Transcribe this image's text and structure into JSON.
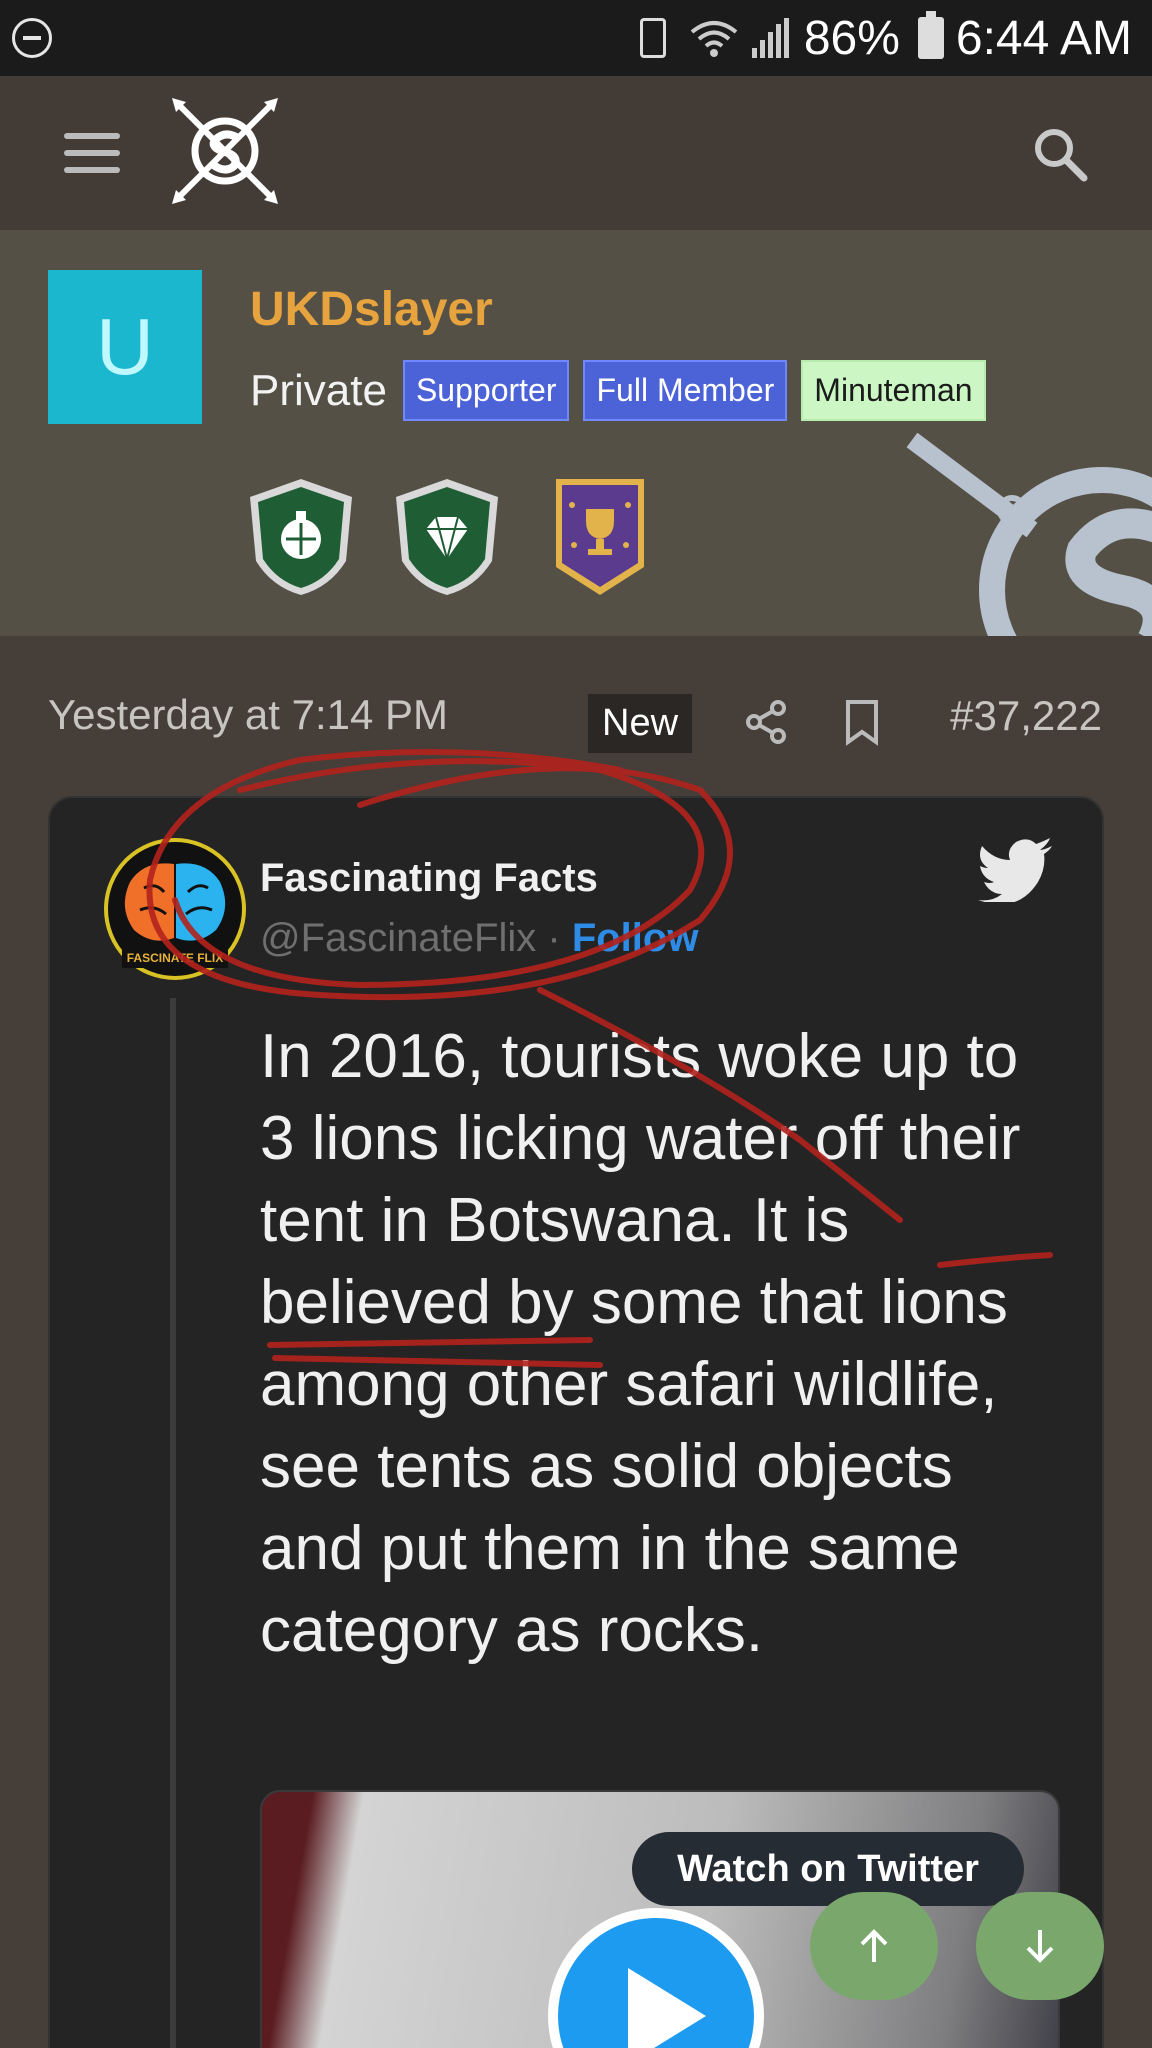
{
  "status_bar": {
    "battery_percent": "86%",
    "time": "6:44 AM"
  },
  "header": {
    "menu_icon": "hamburger-menu-icon",
    "logo_icon": "site-logo-icon",
    "search_icon": "search-icon"
  },
  "profile": {
    "avatar_letter": "U",
    "avatar_color": "#1ab7cf",
    "username": "UKDslayer",
    "rank": "Private",
    "badges": [
      "Supporter",
      "Full Member",
      "Minuteman"
    ],
    "trophy_icons": [
      "grenade-shield-icon",
      "diamond-shield-icon",
      "trophy-banner-icon"
    ]
  },
  "post": {
    "date": "Yesterday at 7:14 PM",
    "new_label": "New",
    "number": "#37,222"
  },
  "tweet": {
    "author_name": "Fascinating Facts",
    "handle": "@FascinateFlix",
    "separator": "·",
    "follow_label": "Follow",
    "avatar_text": "FASCINATE FLIX",
    "text": "In 2016, tourists woke up to 3 lions licking water off their tent in Botswana. It is believed by some that lions among other safari wildlife, see tents as solid objects and put them in the same category as rocks.",
    "watch_label": "Watch on Twitter"
  },
  "colors": {
    "accent_username": "#e6a33e",
    "badge_blue": "#4c63d8",
    "badge_green": "#ccf7c4",
    "twitter_blue": "#1d9bf0",
    "fab_green": "#7aa86c",
    "scribble_red": "#b3221d"
  }
}
